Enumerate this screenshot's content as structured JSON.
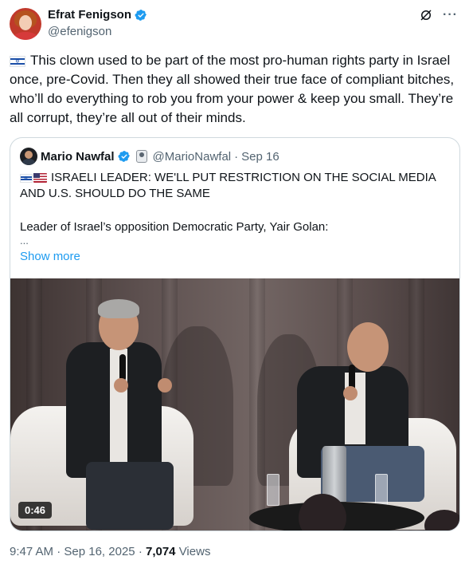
{
  "author": {
    "name": "Efrat Fenigson",
    "handle": "@efenigson",
    "verified": true
  },
  "icons": {
    "verified": "verified-badge-icon",
    "grok": "grok-slash-icon",
    "more": "more-options-icon",
    "flag_israel": "israel-flag-icon",
    "flag_us": "us-flag-icon"
  },
  "colors": {
    "accent": "#1d9bf0",
    "muted": "#536471",
    "text": "#0f1419",
    "border": "#cfd9de"
  },
  "tweet": {
    "text": "This clown used to be part of the most pro-human rights party in Israel once, pre-Covid. Then they all showed their true face of compliant bitches, who’ll do everything to rob you from your power & keep you small. They’re all corrupt, they’re all out of their minds."
  },
  "quote": {
    "name": "Mario Nawfal",
    "handle": "@MarioNawfal",
    "separator": "·",
    "date": "Sep 16",
    "headline": "ISRAELI LEADER: WE'LL PUT RESTRICTION ON THE SOCIAL MEDIA AND U.S. SHOULD DO THE SAME",
    "body": "Leader of Israel’s opposition Democratic Party, Yair Golan:",
    "ellipsis": "...",
    "show_more": "Show more",
    "video_duration": "0:46"
  },
  "meta": {
    "time": "9:47 AM",
    "sep1": "·",
    "date": "Sep 16, 2025",
    "sep2": "·",
    "views_count": "7,074",
    "views_label": "Views"
  }
}
